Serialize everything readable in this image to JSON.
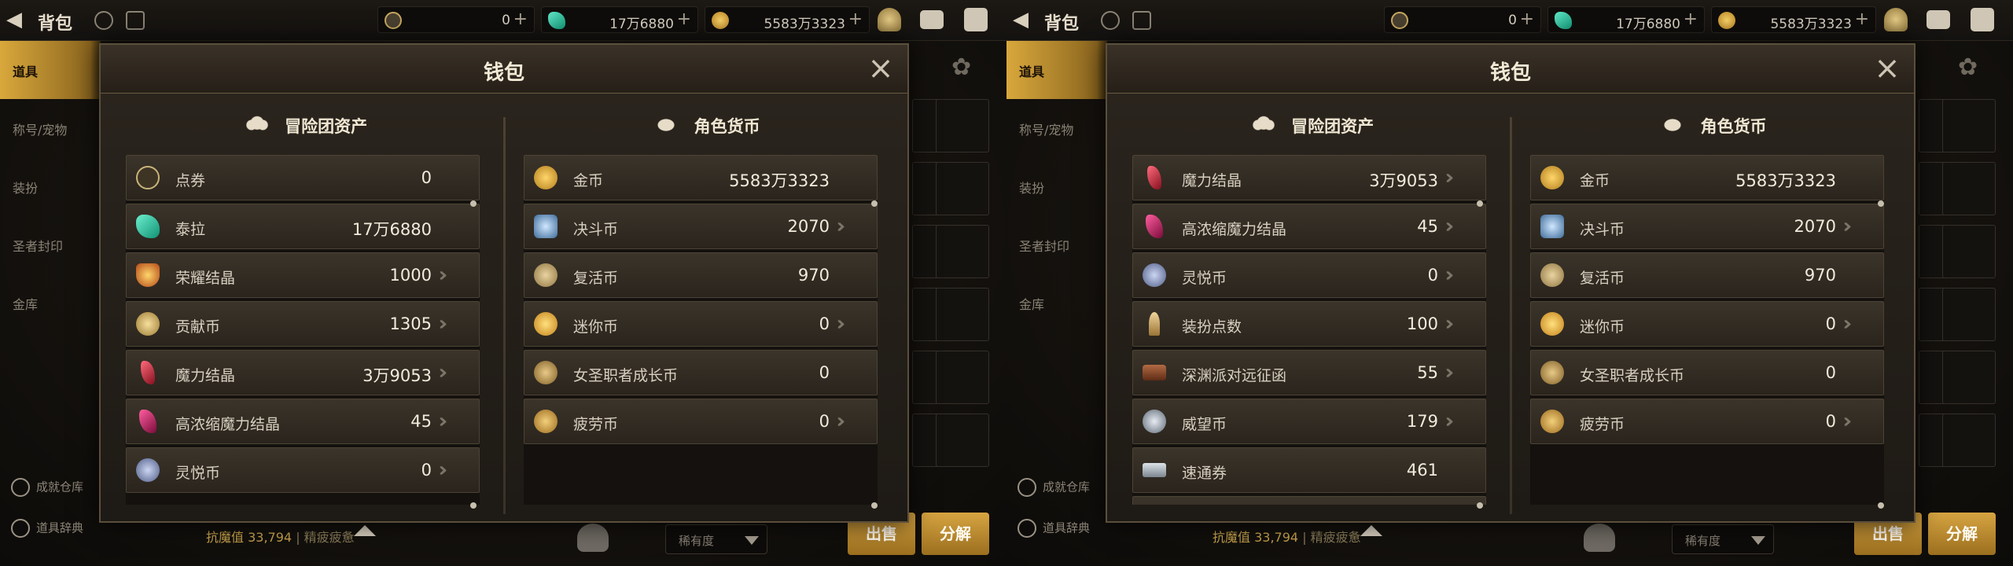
{
  "panels": [
    {
      "topbar": {
        "title": "背包",
        "currencies": [
          {
            "icon": "coupon-coin-icon",
            "value": "0"
          },
          {
            "icon": "terra-gem-icon",
            "value": "17万6880"
          },
          {
            "icon": "gold-coin-icon",
            "value": "5583万3323"
          }
        ]
      },
      "sidebar": {
        "items": [
          "道具",
          "称号/宠物",
          "装扮",
          "圣者封印",
          "金库"
        ],
        "bottom": [
          "成就仓库",
          "道具辞典"
        ]
      },
      "bottombar": {
        "stats_label": "抗魔值",
        "stats_value": "33,794",
        "stats_extra": "精疲疲惫",
        "sort_label": "稀有度",
        "sell_label": "出售",
        "dismantle_label": "分解"
      },
      "dialog": {
        "title": "钱包",
        "left_header": "冒险团资产",
        "right_header": "角色货币",
        "left_rows": [
          {
            "icon": "coupon-coin-icon",
            "label": "点券",
            "value": "0",
            "more": false
          },
          {
            "icon": "terra-gem-icon",
            "label": "泰拉",
            "value": "17万6880",
            "more": false
          },
          {
            "icon": "glory-crystal-icon",
            "label": "荣耀结晶",
            "value": "1000",
            "more": true
          },
          {
            "icon": "contribution-coin-icon",
            "label": "贡献币",
            "value": "1305",
            "more": true
          },
          {
            "icon": "magic-crystal-icon",
            "label": "魔力结晶",
            "value": "3万9053",
            "more": true
          },
          {
            "icon": "concentrated-crystal-icon",
            "label": "高浓缩魔力结晶",
            "value": "45",
            "more": true
          },
          {
            "icon": "joy-coin-icon",
            "label": "灵悦币",
            "value": "0",
            "more": true
          }
        ],
        "right_rows": [
          {
            "icon": "gold-coin-icon",
            "label": "金币",
            "value": "5583万3323",
            "more": false
          },
          {
            "icon": "duel-coin-icon",
            "label": "决斗币",
            "value": "2070",
            "more": true
          },
          {
            "icon": "revive-coin-icon",
            "label": "复活币",
            "value": "970",
            "more": false
          },
          {
            "icon": "mini-coin-icon",
            "label": "迷你币",
            "value": "0",
            "more": true
          },
          {
            "icon": "saintess-coin-icon",
            "label": "女圣职者成长币",
            "value": "0",
            "more": false
          },
          {
            "icon": "fatigue-coin-icon",
            "label": "疲劳币",
            "value": "0",
            "more": true
          }
        ]
      }
    },
    {
      "topbar": {
        "title": "背包",
        "currencies": [
          {
            "icon": "coupon-coin-icon",
            "value": "0"
          },
          {
            "icon": "terra-gem-icon",
            "value": "17万6880"
          },
          {
            "icon": "gold-coin-icon",
            "value": "5583万3323"
          }
        ]
      },
      "sidebar": {
        "items": [
          "道具",
          "称号/宠物",
          "装扮",
          "圣者封印",
          "金库"
        ],
        "bottom": [
          "成就仓库",
          "道具辞典"
        ]
      },
      "bottombar": {
        "stats_label": "抗魔值",
        "stats_value": "33,794",
        "stats_extra": "精疲疲惫",
        "sort_label": "稀有度",
        "sell_label": "出售",
        "dismantle_label": "分解"
      },
      "dialog": {
        "title": "钱包",
        "left_header": "冒险团资产",
        "right_header": "角色货币",
        "left_rows": [
          {
            "icon": "magic-crystal-icon",
            "label": "魔力结晶",
            "value": "3万9053",
            "more": true
          },
          {
            "icon": "concentrated-crystal-icon",
            "label": "高浓缩魔力结晶",
            "value": "45",
            "more": true
          },
          {
            "icon": "joy-coin-icon",
            "label": "灵悦币",
            "value": "0",
            "more": true
          },
          {
            "icon": "costume-point-icon",
            "label": "装扮点数",
            "value": "100",
            "more": true
          },
          {
            "icon": "abyss-letter-icon",
            "label": "深渊派对远征函",
            "value": "55",
            "more": true
          },
          {
            "icon": "prestige-coin-icon",
            "label": "威望币",
            "value": "179",
            "more": true
          },
          {
            "icon": "express-ticket-icon",
            "label": "速通券",
            "value": "461",
            "more": false
          }
        ],
        "right_rows": [
          {
            "icon": "gold-coin-icon",
            "label": "金币",
            "value": "5583万3323",
            "more": false
          },
          {
            "icon": "duel-coin-icon",
            "label": "决斗币",
            "value": "2070",
            "more": true
          },
          {
            "icon": "revive-coin-icon",
            "label": "复活币",
            "value": "970",
            "more": false
          },
          {
            "icon": "mini-coin-icon",
            "label": "迷你币",
            "value": "0",
            "more": true
          },
          {
            "icon": "saintess-coin-icon",
            "label": "女圣职者成长币",
            "value": "0",
            "more": false
          },
          {
            "icon": "fatigue-coin-icon",
            "label": "疲劳币",
            "value": "0",
            "more": true
          }
        ]
      }
    }
  ],
  "colors": {
    "accent_gold": "#d7a441",
    "row_bg": "#3b342a",
    "text_light": "#f2ebdc"
  }
}
